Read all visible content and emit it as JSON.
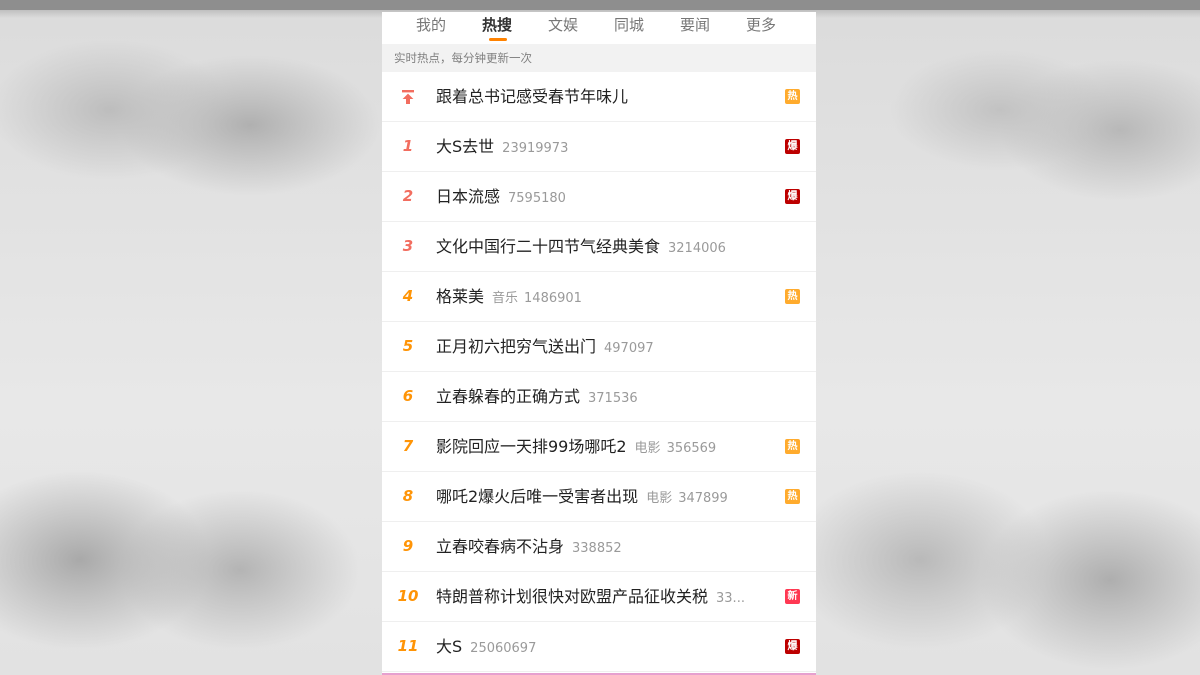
{
  "tabs": [
    {
      "label": "我的",
      "active": false
    },
    {
      "label": "热搜",
      "active": true
    },
    {
      "label": "文娱",
      "active": false
    },
    {
      "label": "同城",
      "active": false
    },
    {
      "label": "要闻",
      "active": false
    },
    {
      "label": "更多",
      "active": false
    }
  ],
  "notice": "实时热点，每分钟更新一次",
  "colors": {
    "accent": "#ff8200",
    "rank_top3": "#f26d5f",
    "rank_mid": "#ff9406",
    "rank_low": "#ffc000",
    "badge_hot": "#ffab2d",
    "badge_boom": "#bd0000",
    "badge_new": "#ff3852"
  },
  "pinned": {
    "icon": "pin-top-icon",
    "title": "跟着总书记感受春节年味儿",
    "badge": "热"
  },
  "items": [
    {
      "rank": "1",
      "title": "大S去世",
      "category": "",
      "count": "23919973",
      "badge": "爆"
    },
    {
      "rank": "2",
      "title": "日本流感",
      "category": "",
      "count": "7595180",
      "badge": "爆"
    },
    {
      "rank": "3",
      "title": "文化中国行二十四节气经典美食",
      "category": "",
      "count": "3214006",
      "badge": ""
    },
    {
      "rank": "4",
      "title": "格莱美",
      "category": "音乐",
      "count": "1486901",
      "badge": "热"
    },
    {
      "rank": "5",
      "title": "正月初六把穷气送出门",
      "category": "",
      "count": "497097",
      "badge": ""
    },
    {
      "rank": "6",
      "title": "立春躲春的正确方式",
      "category": "",
      "count": "371536",
      "badge": ""
    },
    {
      "rank": "7",
      "title": "影院回应一天排99场哪吒2",
      "category": "电影",
      "count": "356569",
      "badge": "热"
    },
    {
      "rank": "8",
      "title": "哪吒2爆火后唯一受害者出现",
      "category": "电影",
      "count": "347899",
      "badge": "热"
    },
    {
      "rank": "9",
      "title": "立春咬春病不沾身",
      "category": "",
      "count": "338852",
      "badge": ""
    },
    {
      "rank": "10",
      "title": "特朗普称计划很快对欧盟产品征收关税",
      "category": "",
      "count": "33...",
      "badge": "新"
    },
    {
      "rank": "11",
      "title": "大S",
      "category": "",
      "count": "25060697",
      "badge": "爆"
    }
  ]
}
